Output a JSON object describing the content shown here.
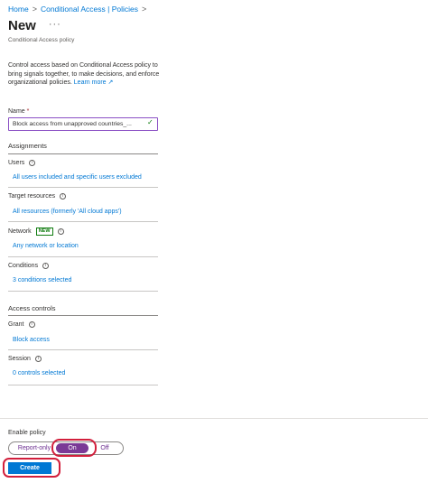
{
  "breadcrumb": {
    "home": "Home",
    "sep1": ">",
    "parent": "Conditional Access | Policies",
    "sep2": ">"
  },
  "header": {
    "title": "New",
    "more": "···",
    "subtitle": "Conditional Access policy"
  },
  "description": {
    "text": "Control access based on Conditional Access policy to bring signals together, to make decisions, and enforce organizational policies.",
    "learn_more": "Learn more",
    "learn_more_icon": "↗"
  },
  "name_field": {
    "label": "Name",
    "required_mark": "*",
    "value": "Block access from unapproved countries_...",
    "valid_icon": "✓"
  },
  "assignments": {
    "heading": "Assignments",
    "users": {
      "label": "Users",
      "value": "All users included and specific users excluded"
    },
    "target_resources": {
      "label": "Target resources",
      "value": "All resources (formerly 'All cloud apps')"
    },
    "network": {
      "label": "Network",
      "badge": "NEW",
      "value": "Any network or location"
    },
    "conditions": {
      "label": "Conditions",
      "value": "3 conditions selected"
    }
  },
  "access_controls": {
    "heading": "Access controls",
    "grant": {
      "label": "Grant",
      "value": "Block access"
    },
    "session": {
      "label": "Session",
      "value": "0 controls selected"
    }
  },
  "enable_policy": {
    "label": "Enable policy",
    "options": [
      "Report-only",
      "On",
      "Off"
    ],
    "selected": "On"
  },
  "actions": {
    "create": "Create"
  },
  "colors": {
    "link": "#0078d4",
    "primary": "#0078d4",
    "toggle_selected": "#7a3a96",
    "highlight": "#d21f3c",
    "badge": "#107c10"
  },
  "info_icon_glyph": "i"
}
